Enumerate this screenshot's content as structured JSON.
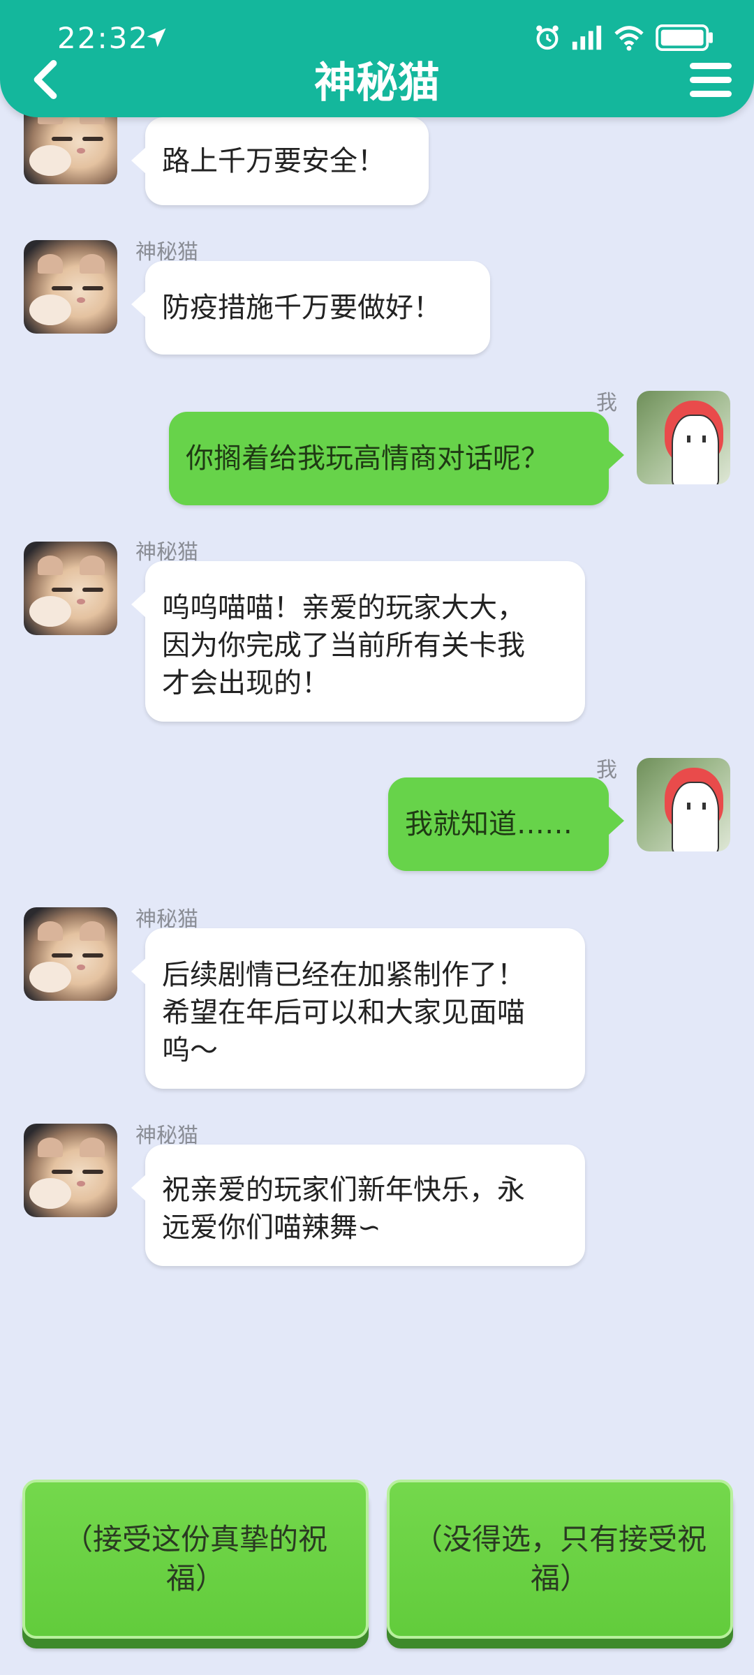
{
  "status": {
    "time": "22:32"
  },
  "header": {
    "title": "神秘猫",
    "back_icon": "chevron-left-icon",
    "menu_icon": "hamburger-menu-icon"
  },
  "messages": [
    {
      "side": "left",
      "sender": "",
      "text": "路上千万要安全！"
    },
    {
      "side": "left",
      "sender": "神秘猫",
      "text": "防疫措施千万要做好！"
    },
    {
      "side": "right",
      "sender": "我",
      "text": "你搁着给我玩高情商对话呢？"
    },
    {
      "side": "left",
      "sender": "神秘猫",
      "lines": [
        "呜呜喵喵！亲爱的玩家大大，",
        "因为你完成了当前所有关卡我",
        "才会出现的！"
      ]
    },
    {
      "side": "right",
      "sender": "我",
      "text": "我就知道……"
    },
    {
      "side": "left",
      "sender": "神秘猫",
      "lines": [
        "后续剧情已经在加紧制作了！",
        "希望在年后可以和大家见面喵",
        "呜～"
      ]
    },
    {
      "side": "left",
      "sender": "神秘猫",
      "lines": [
        "祝亲爱的玩家们新年快乐，永",
        "远爱你们喵辣舞∽"
      ]
    }
  ],
  "choices": [
    {
      "label": "（接受这份真挚的祝福）"
    },
    {
      "line1": "（没得选，只有接受祝",
      "line2": "福）"
    }
  ],
  "colors": {
    "header": "#14b79c",
    "background": "#e3e8f8",
    "my_bubble": "#67d34a",
    "button": "#67d34a"
  }
}
